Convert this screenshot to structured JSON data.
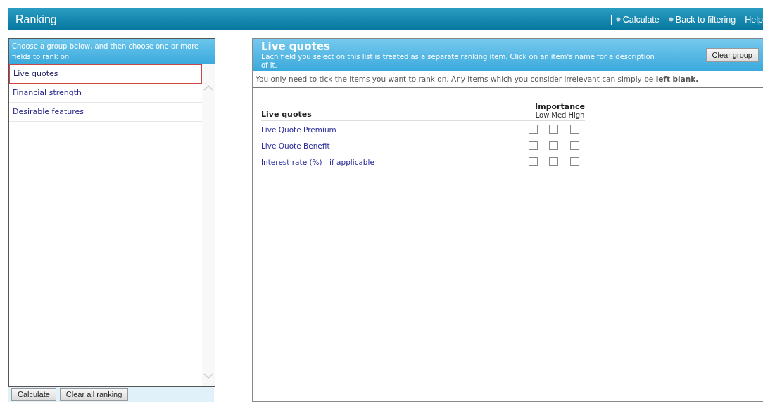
{
  "header": {
    "title": "Ranking",
    "links": [
      {
        "label": "Calculate",
        "icon": true
      },
      {
        "label": "Back to filtering",
        "icon": true
      },
      {
        "label": "Help",
        "icon": false
      }
    ]
  },
  "groups_panel": {
    "instruction": "Choose a group below, and then choose one or more fields to rank on",
    "items": [
      {
        "label": "Live quotes",
        "selected": true
      },
      {
        "label": "Financial strength",
        "selected": false
      },
      {
        "label": "Desirable features",
        "selected": false
      }
    ],
    "buttons": [
      "Calculate",
      "Clear all ranking"
    ]
  },
  "fields_panel": {
    "title": "Live quotes",
    "description": "Each field you select on this list is treated as a separate ranking item. Click on an item's name for a description of it.",
    "clear_button": "Clear group",
    "hint": "You only need to tick the items you want to rank on. Any items which you consider irrelevant can simply be **left blank.**",
    "table": {
      "group_heading": "Live quotes",
      "importance_heading": "Importance",
      "levels": [
        "Low",
        "Med",
        "High"
      ],
      "rows": [
        {
          "label": "Live Quote Premium",
          "checks": [
            false,
            false,
            false
          ]
        },
        {
          "label": "Live Quote Benefit",
          "checks": [
            false,
            false,
            false
          ]
        },
        {
          "label": "Interest rate (%) - if applicable",
          "checks": [
            false,
            false,
            false
          ]
        }
      ]
    }
  }
}
